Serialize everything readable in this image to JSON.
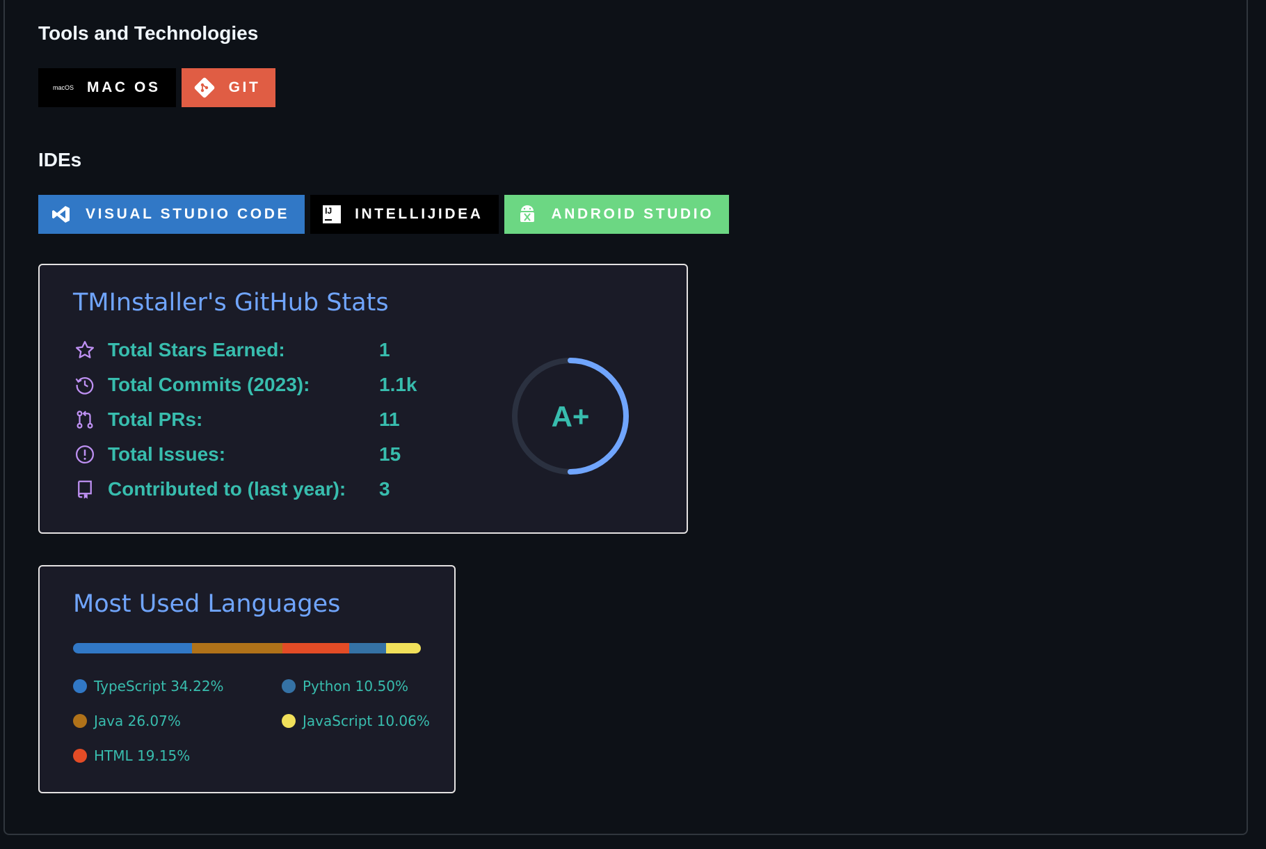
{
  "tools": {
    "heading": "Tools and Technologies",
    "badges": [
      {
        "icon_text": "macOS",
        "label": "MAC OS",
        "color": "#000000"
      },
      {
        "label": "GIT",
        "color": "#e05d44"
      }
    ]
  },
  "ides": {
    "heading": "IDEs",
    "badges": [
      {
        "label": "VISUAL STUDIO CODE",
        "color": "#3178c6"
      },
      {
        "icon_text": "IJ",
        "label": "INTELLIJIDEA",
        "color": "#000000"
      },
      {
        "label": "ANDROID STUDIO",
        "color": "#6cd783"
      }
    ]
  },
  "stats": {
    "title": "TMInstaller's GitHub Stats",
    "rows": [
      {
        "icon": "star-icon",
        "label": "Total Stars Earned:",
        "value": "1"
      },
      {
        "icon": "history-icon",
        "label": "Total Commits (2023):",
        "value": "1.1k"
      },
      {
        "icon": "pull-request-icon",
        "label": "Total PRs:",
        "value": "11"
      },
      {
        "icon": "issue-icon",
        "label": "Total Issues:",
        "value": "15"
      },
      {
        "icon": "repo-icon",
        "label": "Contributed to (last year):",
        "value": "3"
      }
    ],
    "rank": "A+",
    "rank_progress": 0.5,
    "colors": {
      "title": "#70a5fd",
      "text": "#38bdae",
      "icon": "#bf91f3",
      "ring": "#70a5fd",
      "ring_track": "#2b3140"
    }
  },
  "languages": {
    "title": "Most Used Languages",
    "items": [
      {
        "name": "TypeScript",
        "percent": 34.22,
        "text": "TypeScript 34.22%",
        "color": "#3178c6"
      },
      {
        "name": "Java",
        "percent": 26.07,
        "text": "Java 26.07%",
        "color": "#b07219"
      },
      {
        "name": "HTML",
        "percent": 19.15,
        "text": "HTML 19.15%",
        "color": "#e34c26"
      },
      {
        "name": "Python",
        "percent": 10.5,
        "text": "Python 10.50%",
        "color": "#3572a5"
      },
      {
        "name": "JavaScript",
        "percent": 10.06,
        "text": "JavaScript 10.06%",
        "color": "#f1e05a"
      }
    ]
  }
}
